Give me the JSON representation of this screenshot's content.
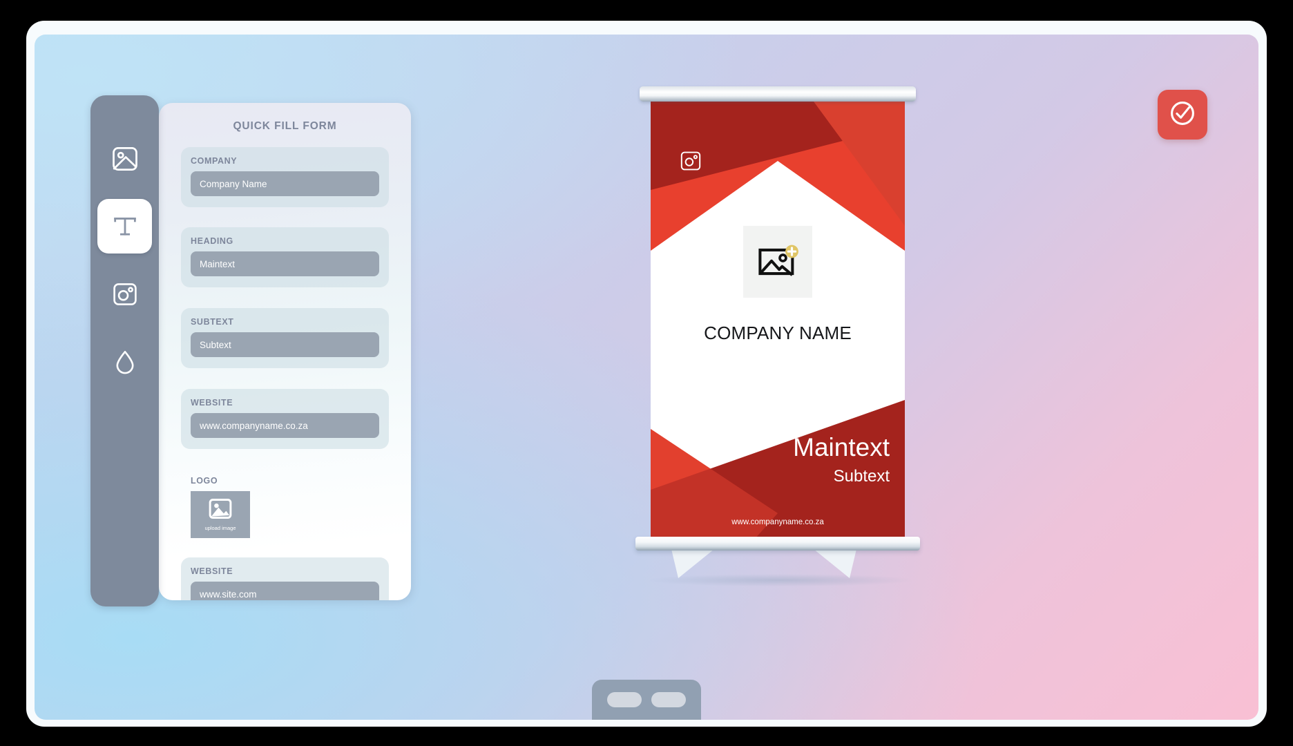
{
  "app": {
    "background_color": "#000000",
    "canvas_gradient": [
      "#bcd9f2",
      "#c8cfeb",
      "#d3c9e6",
      "#eec3da",
      "#f9c0d4"
    ],
    "accent_color": "#e0514a",
    "rail_color": "#7e8a9c"
  },
  "tool_rail": {
    "items": [
      {
        "icon": "image-icon",
        "name": "image-tool",
        "active": false
      },
      {
        "icon": "text-icon",
        "name": "text-tool",
        "active": true
      },
      {
        "icon": "camera-icon",
        "name": "camera-tool",
        "active": false
      },
      {
        "icon": "droplet-icon",
        "name": "color-tool",
        "active": false
      }
    ]
  },
  "form": {
    "title": "QUICK FILL FORM",
    "fields": [
      {
        "label": "COMPANY",
        "value": "Company Name",
        "placeholder": "Company Name"
      },
      {
        "label": "HEADING",
        "value": "Maintext",
        "placeholder": "Maintext"
      },
      {
        "label": "SUBTEXT",
        "value": "Subtext",
        "placeholder": "Subtext"
      },
      {
        "label": "WEBSITE",
        "value": "www.companyname.co.za",
        "placeholder": "www.companyname.co.za"
      }
    ],
    "logo": {
      "label": "LOGO",
      "upload_caption": "upload image",
      "icon": "image-placeholder-icon"
    },
    "website_field": {
      "label": "WEBSITE",
      "value": "www.site.com",
      "placeholder": "www.site.com"
    }
  },
  "banner": {
    "company_name": "COMPANY NAME",
    "maintext": "Maintext",
    "subtext": "Subtext",
    "website": "www.companyname.co.za",
    "social_icon": "camera-icon",
    "logo_icon": "add-image-icon",
    "colors": {
      "red_light": "#e8402e",
      "red_mid": "#d9402f",
      "red_dark": "#a4231d",
      "red_darker": "#9e2019",
      "white": "#ffffff",
      "logo_badge": "#e0c566"
    }
  },
  "confirm_button": {
    "icon": "check-circle-icon",
    "color": "#e0514a"
  },
  "bottom_dock": {
    "pills": [
      "dock-pill-left",
      "dock-pill-right"
    ]
  }
}
